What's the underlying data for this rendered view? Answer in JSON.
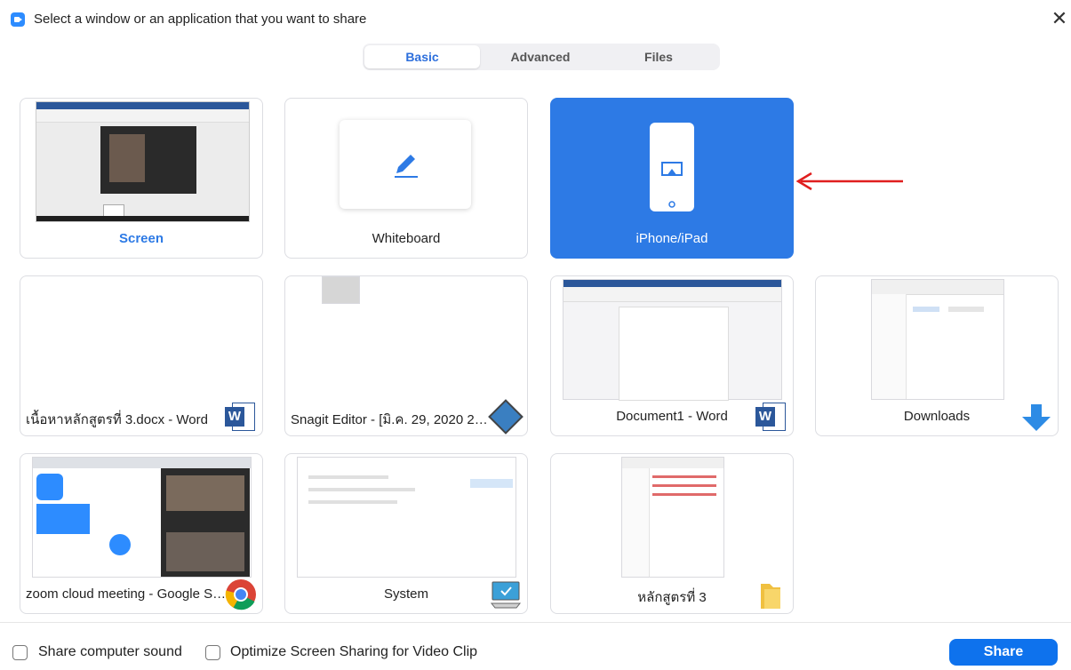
{
  "window": {
    "title": "Select a window or an application that you want to share",
    "close_label": "✕"
  },
  "tabs": [
    {
      "label": "Basic",
      "active": true
    },
    {
      "label": "Advanced",
      "active": false
    },
    {
      "label": "Files",
      "active": false
    }
  ],
  "cards": [
    {
      "label": "Screen",
      "icon": "screen-preview"
    },
    {
      "label": "Whiteboard",
      "icon": "pencil-icon"
    },
    {
      "label": "iPhone/iPad",
      "icon": "iphone-airplay-icon",
      "selected": true
    },
    {
      "label": "เนื้อหาหลักสูตรที่ 3.docx - Word",
      "icon": "word-icon"
    },
    {
      "label": "Snagit Editor - [มิ.ค. 29, 2020 22:1...",
      "icon": "snagit-icon"
    },
    {
      "label": "Document1 - Word",
      "icon": "word-icon"
    },
    {
      "label": "Downloads",
      "icon": "download-arrow-icon"
    },
    {
      "label": "zoom cloud meeting - Google Se...",
      "icon": "chrome-icon"
    },
    {
      "label": "System",
      "icon": "system-monitor-icon"
    },
    {
      "label": "หลักสูตรที่ 3",
      "icon": "folder-icon"
    }
  ],
  "footer": {
    "share_sound_label": "Share computer sound",
    "optimize_label": "Optimize Screen Sharing for Video Clip",
    "share_button": "Share"
  },
  "colors": {
    "accent": "#2d7ae5",
    "share_button": "#0e72ed",
    "annotation_arrow": "#e01e1e"
  }
}
